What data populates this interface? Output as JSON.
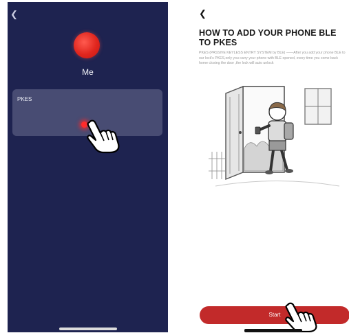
{
  "left_screen": {
    "back_icon": "chevron-left-icon",
    "profile": {
      "label": "Me",
      "avatar_color": "#e0261e"
    },
    "card": {
      "label": "PKES"
    },
    "background_color": "#1e2350",
    "card_color": "#484c73"
  },
  "right_screen": {
    "back_icon": "chevron-left-icon",
    "title": "HOW TO ADD YOUR PHONE BLE TO PKES",
    "description": "PKES (PASSIVE KEYLESS ENTRY SYSTEM by BLE) ——After you add your phone BLE to our lock's PKES,only you carry your phone with BLE opened, every time you come back home closing the door ,the lock will auto unlock",
    "illustration": "boy-opening-door-with-phone",
    "start_button": {
      "label": "Start",
      "color": "#c22a2a"
    }
  }
}
